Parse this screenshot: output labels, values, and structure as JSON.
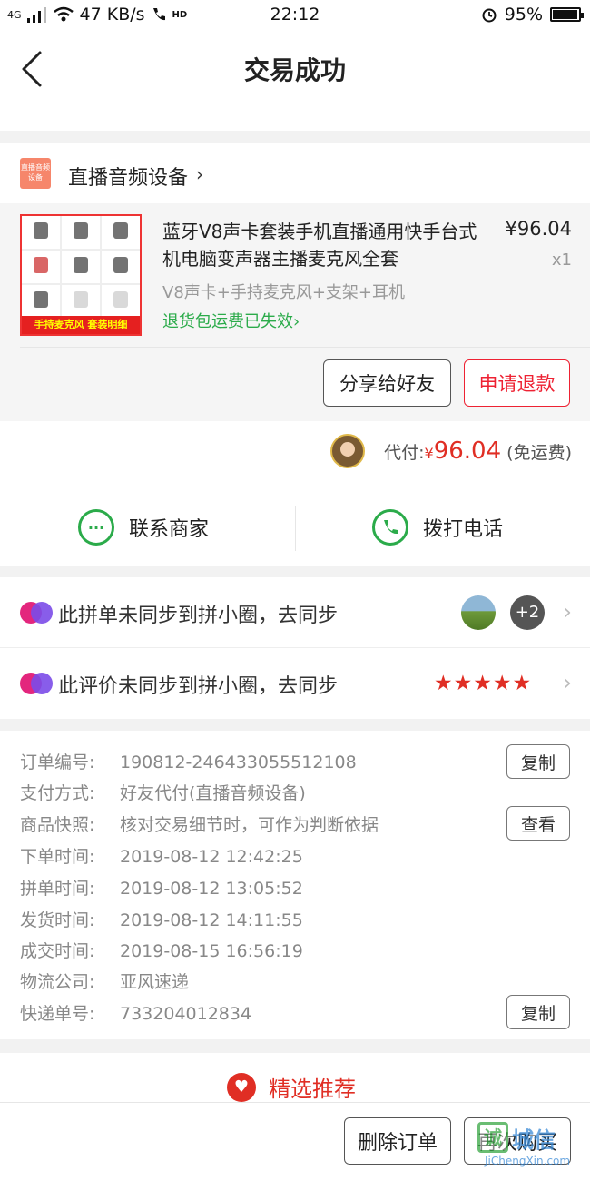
{
  "status_bar": {
    "signal_label": "4G",
    "speed": "47 KB/s",
    "hd_label": "HD",
    "time": "22:12",
    "battery": "95%",
    "battery_level": 0.95
  },
  "nav": {
    "title": "交易成功"
  },
  "store": {
    "logo_text": "直播音频设备",
    "name": "直播音频设备",
    "arrow": "›"
  },
  "product": {
    "title": "蓝牙V8声卡套装手机直播通用快手台式机电脑变声器主播麦克风全套",
    "price": "¥96.04",
    "quantity": "x1",
    "variant": "V8声卡+手持麦克风+支架+耳机",
    "refund_note": "退货包运费已失效",
    "refund_note_arrow": "›",
    "thumb_banner": "手持麦克风  套装明细",
    "share_button": "分享给好友",
    "refund_button": "申请退款"
  },
  "payment": {
    "label": "代付:",
    "currency": "¥",
    "amount": "96.04",
    "shipping": "(免运费)"
  },
  "contact": {
    "merchant": "联系商家",
    "call": "拨打电话"
  },
  "sync": {
    "order_text": "此拼单未同步到拼小圈，去同步",
    "review_text": "此评价未同步到拼小圈，去同步",
    "extra_count": "+2",
    "stars": "★★★★★",
    "rating": 5,
    "chevron": "›"
  },
  "order_info": {
    "rows": [
      {
        "label": "订单编号:",
        "value": "190812-246433055512108"
      },
      {
        "label": "支付方式:",
        "value": "好友代付(直播音频设备)"
      },
      {
        "label": "商品快照:",
        "value": "核对交易细节时，可作为判断依据"
      },
      {
        "label": "下单时间:",
        "value": "2019-08-12 12:42:25"
      },
      {
        "label": "拼单时间:",
        "value": "2019-08-12 13:05:52"
      },
      {
        "label": "发货时间:",
        "value": "2019-08-12 14:11:55"
      },
      {
        "label": "成交时间:",
        "value": "2019-08-15 16:56:19"
      },
      {
        "label": "物流公司:",
        "value": "亚风速递"
      },
      {
        "label": "快递单号:",
        "value": "733204012834"
      }
    ],
    "copy_label": "复制",
    "view_label": "查看"
  },
  "recommend": {
    "title": "精选推荐"
  },
  "bottom": {
    "delete_button": "删除订单",
    "rebuy_button": "再次购买"
  },
  "watermark": {
    "icon_text": "诚",
    "big_text": "城信",
    "url": "JiChengXin.com"
  },
  "colors": {
    "accent_red": "#e02e24",
    "green": "#2bab4a",
    "background": "#f2f2f2"
  }
}
